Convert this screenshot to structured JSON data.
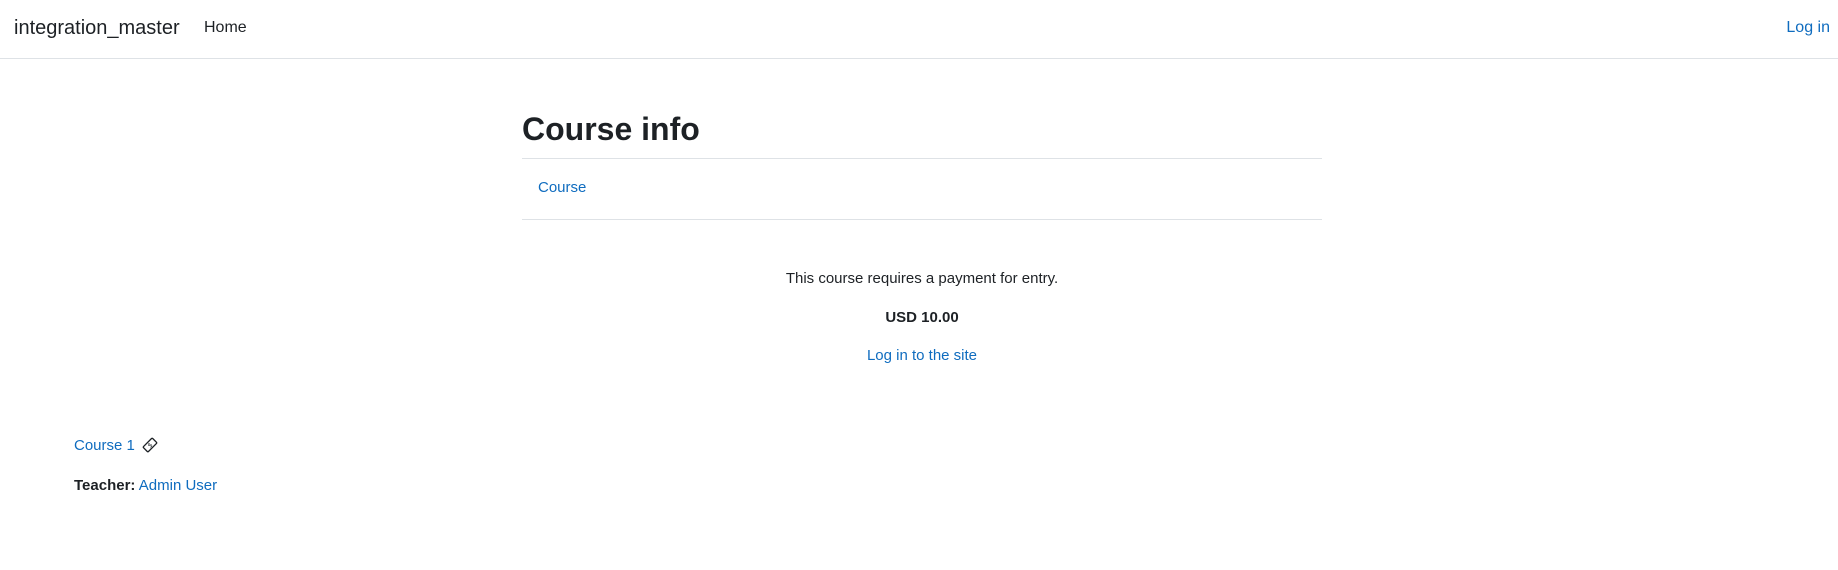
{
  "navbar": {
    "brand": "integration_master",
    "home_label": "Home",
    "login_label": "Log in"
  },
  "page": {
    "title": "Course info",
    "secondary_nav": {
      "tabs": [
        {
          "label": "Course"
        }
      ]
    }
  },
  "payment": {
    "message": "This course requires a payment for entry.",
    "cost": "USD 10.00",
    "login_link": "Log in to the site"
  },
  "course_box": {
    "course_name": "Course 1",
    "enrol_icon": "payment-ticket-icon",
    "teacher_label": "Teacher:",
    "teacher_name": "Admin User"
  },
  "colors": {
    "link": "#0f6cbf",
    "text": "#1d2125",
    "border": "#dee2e6"
  }
}
